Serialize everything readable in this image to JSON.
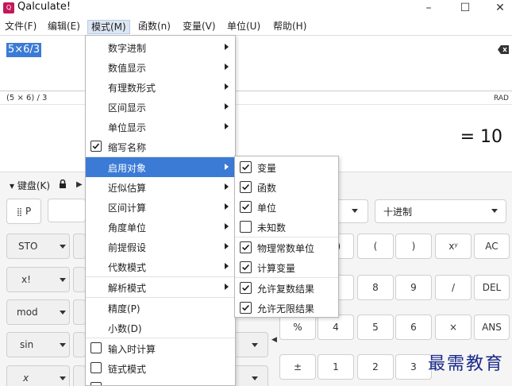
{
  "window": {
    "title": "Qalculate!",
    "icon_text": "Q",
    "minimize": "–",
    "maximize": "☐",
    "close": "✕"
  },
  "menubar": {
    "file": "文件(F)",
    "edit": "编辑(E)",
    "mode": "模式(M)",
    "functions": "函数(n)",
    "variables": "变量(V)",
    "units": "单位(U)",
    "help": "帮助(H)"
  },
  "expression": {
    "input": "5×6/3",
    "parsed": "(5 × 6) / 3",
    "angle_unit": "RAD",
    "result": "= 10"
  },
  "keypad": {
    "toggle_label": "▾ 键盘(K)",
    "p_button": "P",
    "base_combo": "十进制",
    "left_buttons": [
      "STO",
      "x!",
      "mod",
      "sin",
      "x"
    ],
    "right_buttons": {
      "r1": [
        "(",
        ")",
        "xʸ",
        "AC"
      ],
      "r2": [
        "8",
        "9",
        "/",
        "DEL"
      ],
      "r3": [
        "%",
        "4",
        "5",
        "6",
        "×",
        "ANS"
      ],
      "r4": [
        "±",
        "1",
        "2",
        "3"
      ]
    },
    "partial_r1": "3)",
    "partial_r2": "7"
  },
  "mode_menu": {
    "items": [
      "数字进制",
      "数值显示",
      "有理数形式",
      "区间显示",
      "单位显示",
      "缩写名称",
      "启用对象",
      "近似估算",
      "区间计算",
      "角度单位",
      "前提假设",
      "代数模式",
      "解析模式",
      "精度(P)",
      "小数(D)",
      "输入时计算",
      "链式模式"
    ]
  },
  "enable_submenu": {
    "items": [
      {
        "label": "变量",
        "checked": true
      },
      {
        "label": "函数",
        "checked": true
      },
      {
        "label": "单位",
        "checked": true
      },
      {
        "label": "未知数",
        "checked": false
      },
      {
        "label": "物理常数单位",
        "checked": true
      },
      {
        "label": "计算变量",
        "checked": true
      },
      {
        "label": "允许复数结果",
        "checked": true
      },
      {
        "label": "允许无限结果",
        "checked": true
      }
    ]
  },
  "watermark": "最需教育",
  "colors": {
    "highlight": "#3b7bd5",
    "watermark": "#1a2a8a"
  }
}
